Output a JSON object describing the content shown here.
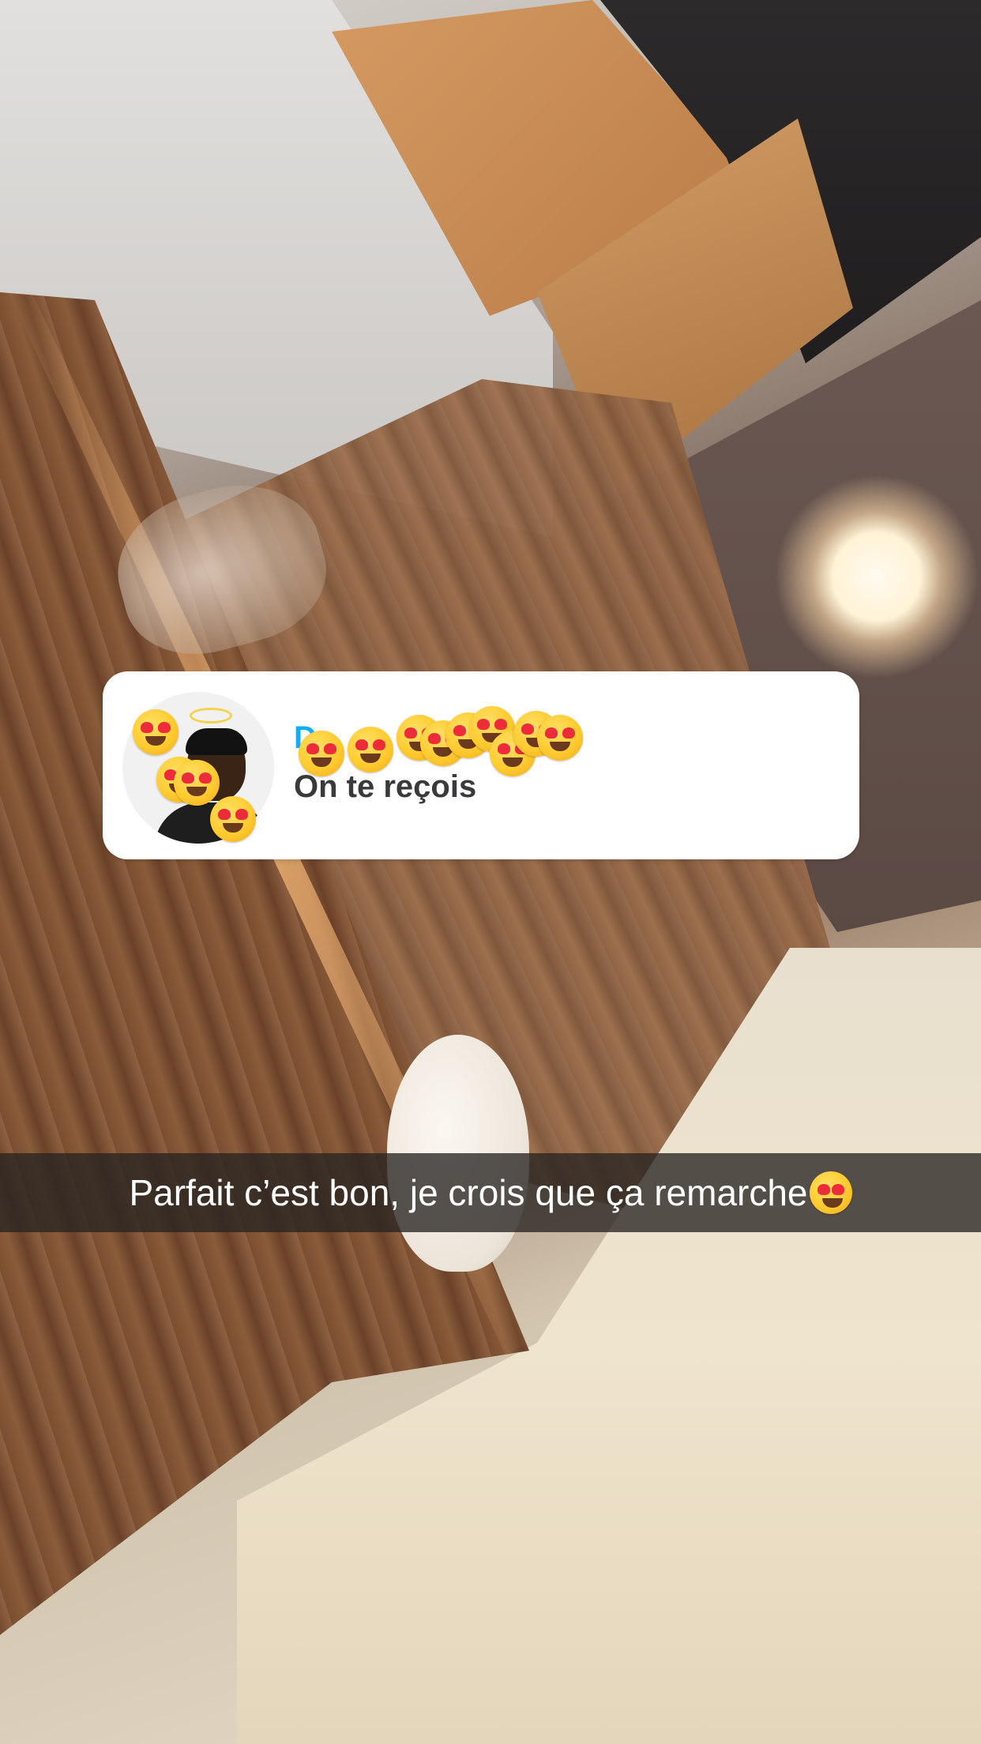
{
  "story": {
    "reply_card": {
      "username": "D",
      "message": "On te reçois",
      "avatar": "bitmoji-avatar"
    },
    "stickers": {
      "icon": "heart-eyes-emoji",
      "count": 13
    },
    "caption": {
      "text": "Parfait c’est bon, je crois que ça remarche",
      "trailing_emoji": "heart-eyes-emoji"
    }
  }
}
